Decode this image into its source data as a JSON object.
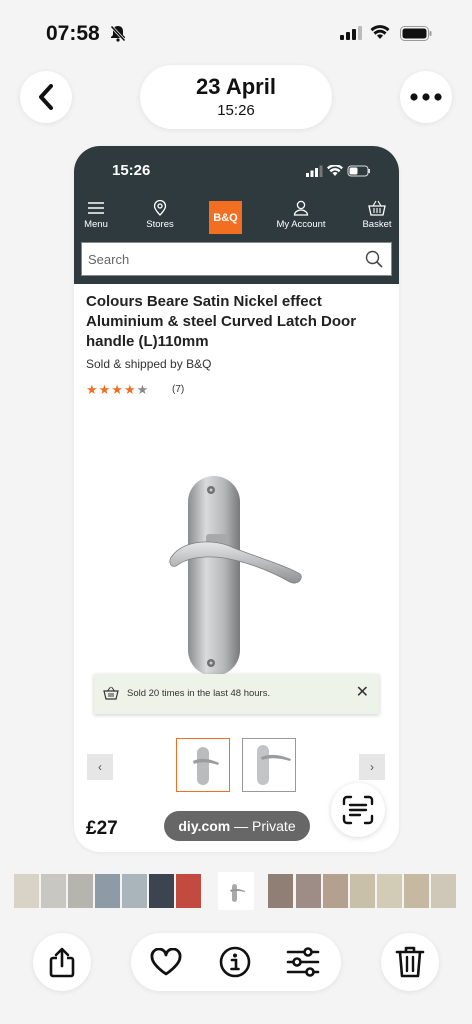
{
  "status_bar": {
    "time": "07:58"
  },
  "header": {
    "date": "23 April",
    "time": "15:26"
  },
  "shot": {
    "status_time": "15:26",
    "nav": {
      "menu": "Menu",
      "stores": "Stores",
      "logo": "B&Q",
      "account": "My Account",
      "basket": "Basket"
    },
    "search_placeholder": "Search",
    "product": {
      "title": "Colours Beare Satin Nickel effect Aluminium & steel Curved Latch Door handle (L)110mm",
      "seller": "Sold & shipped by B&Q",
      "rating": 4,
      "rating_stars": "★★★★",
      "rating_off": "★",
      "review_count": "(7)",
      "price": "£27"
    },
    "toast": {
      "text": "Sold 20 times in the last 48 hours.",
      "close": "✕"
    },
    "gallery": {
      "prev": "‹",
      "next": "›"
    },
    "watermark": {
      "source": "diy.com",
      "separator": " — ",
      "mode": "Private"
    }
  },
  "colors": {
    "bq_orange": "#f26f21",
    "header_dark": "#2f3a3f"
  },
  "icons": [
    "chevron-left-icon",
    "more-icon",
    "share-icon",
    "heart-icon",
    "info-icon",
    "adjust-icon",
    "trash-icon",
    "live-text-icon"
  ]
}
